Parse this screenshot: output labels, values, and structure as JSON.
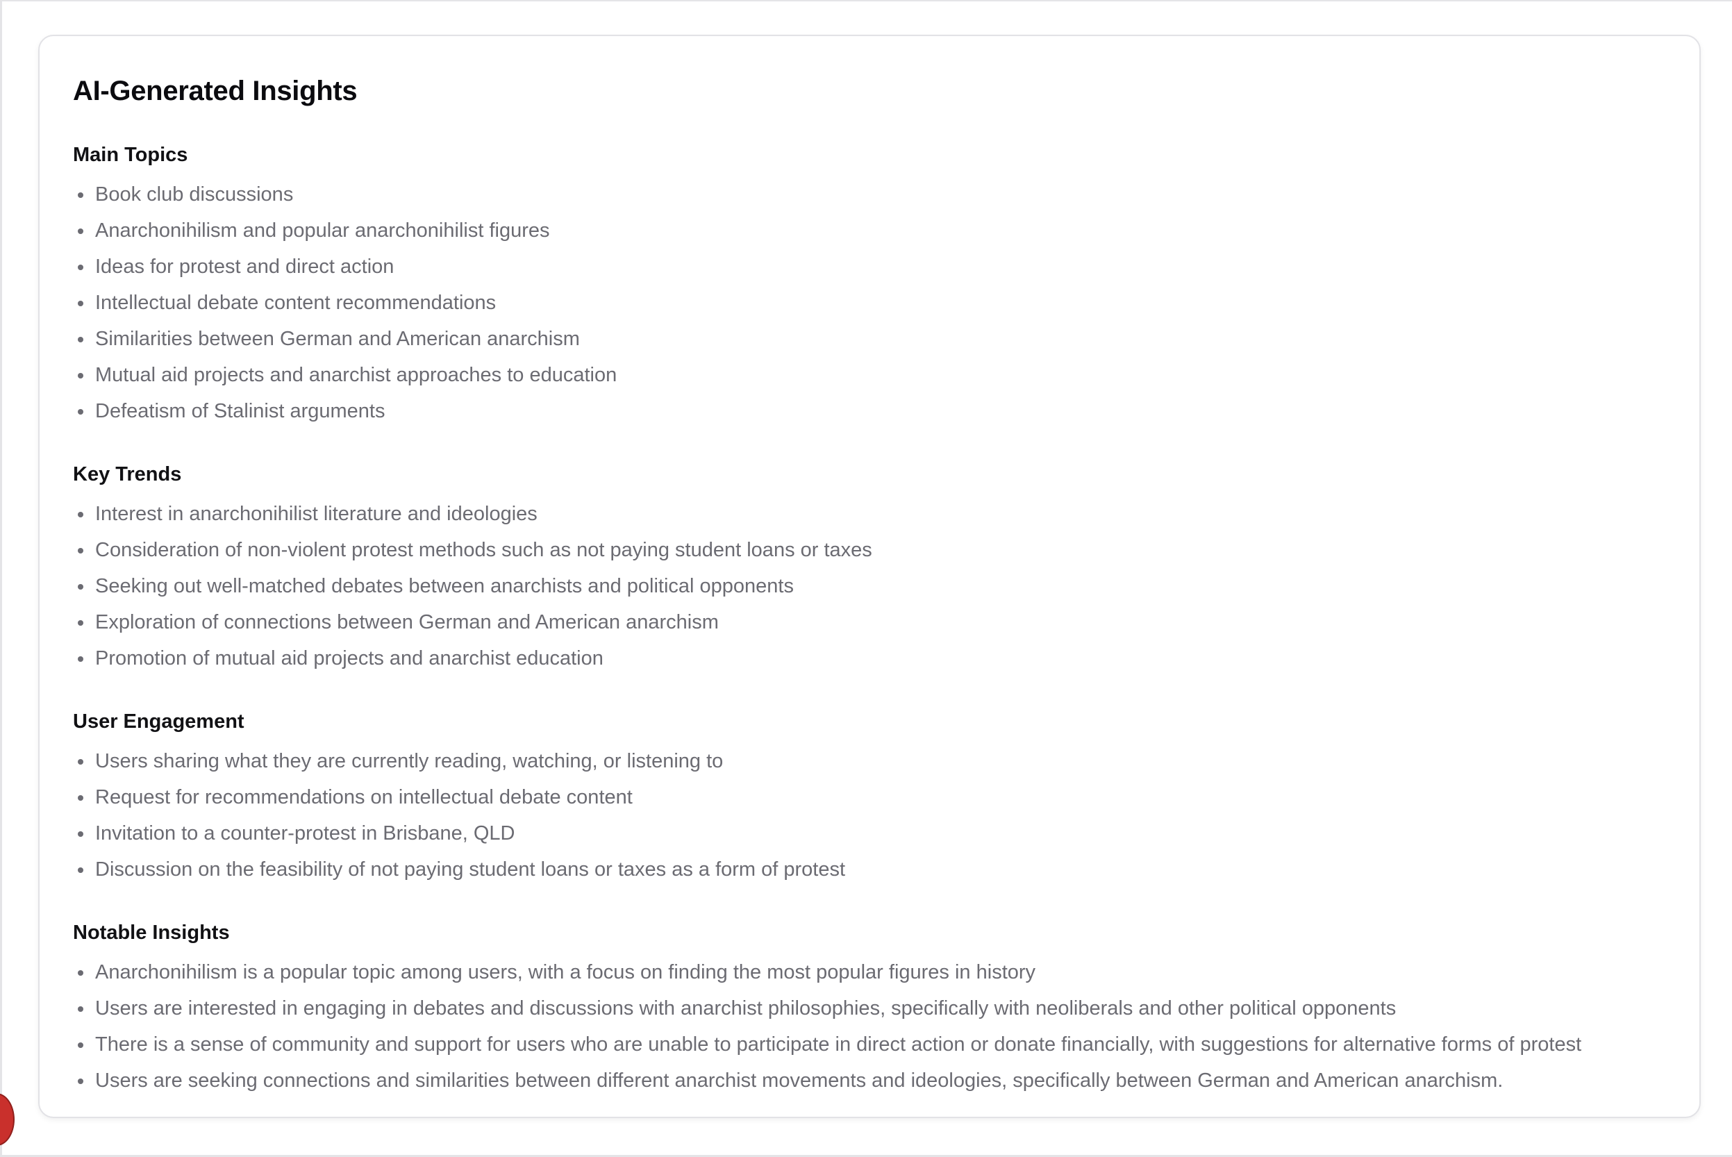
{
  "card": {
    "title": "AI-Generated Insights",
    "sections": [
      {
        "title": "Main Topics",
        "items": [
          "Book club discussions",
          "Anarchonihilism and popular anarchonihilist figures",
          "Ideas for protest and direct action",
          "Intellectual debate content recommendations",
          "Similarities between German and American anarchism",
          "Mutual aid projects and anarchist approaches to education",
          "Defeatism of Stalinist arguments"
        ]
      },
      {
        "title": "Key Trends",
        "items": [
          "Interest in anarchonihilist literature and ideologies",
          "Consideration of non-violent protest methods such as not paying student loans or taxes",
          "Seeking out well-matched debates between anarchists and political opponents",
          "Exploration of connections between German and American anarchism",
          "Promotion of mutual aid projects and anarchist education"
        ]
      },
      {
        "title": "User Engagement",
        "items": [
          "Users sharing what they are currently reading, watching, or listening to",
          "Request for recommendations on intellectual debate content",
          "Invitation to a counter-protest in Brisbane, QLD",
          "Discussion on the feasibility of not paying student loans or taxes as a form of protest"
        ]
      },
      {
        "title": "Notable Insights",
        "items": [
          "Anarchonihilism is a popular topic among users, with a focus on finding the most popular figures in history",
          "Users are interested in engaging in debates and discussions with anarchist philosophies, specifically with neoliberals and other political opponents",
          "There is a sense of community and support for users who are unable to participate in direct action or donate financially, with suggestions for alternative forms of protest",
          "Users are seeking connections and similarities between different anarchist movements and ideologies, specifically between German and American anarchism."
        ]
      }
    ]
  },
  "colors": {
    "title_text": "#0b0b0f",
    "body_text": "#6b6b72",
    "card_border": "#e2e2e6",
    "floating_button": "#c9302c"
  }
}
